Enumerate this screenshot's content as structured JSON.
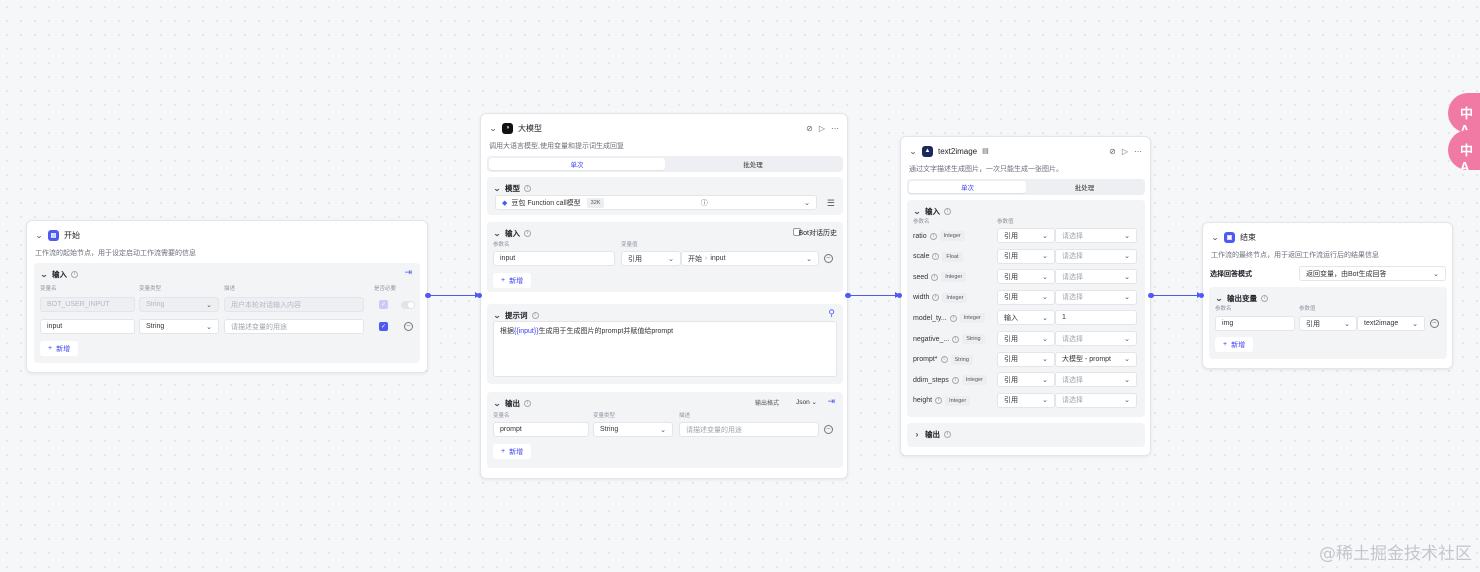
{
  "start": {
    "title": "开始",
    "desc": "工作流的起始节点，用于设定启动工作流需要的信息",
    "input_label": "输入",
    "col_var": "变量名",
    "col_type": "变量类型",
    "col_desc": "描述",
    "col_required": "是否必要",
    "rows": [
      {
        "name": "BOT_USER_INPUT",
        "type": "String",
        "desc": "用户本轮对话输入内容"
      },
      {
        "name": "input",
        "type": "String",
        "desc": "请描述变量的用途"
      }
    ],
    "add_label": "新增"
  },
  "llm": {
    "title": "大模型",
    "desc": "调用大语言模型,使用变量和提示词生成回复",
    "tab_single": "单次",
    "tab_batch": "批处理",
    "model_label": "模型",
    "model_name": "豆包 Function call模型",
    "model_ctx": "32K",
    "input_label": "输入",
    "bot_history": "Bot对话历史",
    "col_param": "参数名",
    "col_value": "变量值",
    "input_row": {
      "name": "input",
      "mode": "引用",
      "src_node": "开始",
      "src_var": "input"
    },
    "add_label": "新增",
    "prompt_label": "提示词",
    "prompt_before": "根据",
    "prompt_var": "{{input}}",
    "prompt_after": "生成用于生成图片的prompt并赋值给prompt",
    "output_label": "输出",
    "output_format_label": "输出格式",
    "output_format": "Json",
    "col_var": "变量名",
    "col_type": "变量类型",
    "col_desc": "描述",
    "output_row": {
      "name": "prompt",
      "type": "String",
      "desc": "请描述变量的用途"
    }
  },
  "t2i": {
    "title": "text2image",
    "desc": "通过文字描述生成图片，一次只能生成一张图片。",
    "tab_single": "单次",
    "tab_batch": "批处理",
    "input_label": "输入",
    "col_param": "参数名",
    "col_value": "参数值",
    "params": [
      {
        "name": "ratio",
        "type": "Integer",
        "mode": "引用",
        "value": "请选择",
        "ph": true
      },
      {
        "name": "scale",
        "type": "Float",
        "mode": "引用",
        "value": "请选择",
        "ph": true
      },
      {
        "name": "seed",
        "type": "Integer",
        "mode": "引用",
        "value": "请选择",
        "ph": true
      },
      {
        "name": "width",
        "type": "Integer",
        "mode": "引用",
        "value": "请选择",
        "ph": true
      },
      {
        "name": "model_ty...",
        "type": "Integer",
        "mode": "输入",
        "value": "1",
        "ph": false
      },
      {
        "name": "negative_...",
        "type": "String",
        "mode": "引用",
        "value": "请选择",
        "ph": true
      },
      {
        "name": "prompt*",
        "type": "String",
        "mode": "引用",
        "value": "大模型 - prompt",
        "ph": false
      },
      {
        "name": "ddim_steps",
        "type": "Integer",
        "mode": "引用",
        "value": "请选择",
        "ph": true
      },
      {
        "name": "height",
        "type": "Integer",
        "mode": "引用",
        "value": "请选择",
        "ph": true
      }
    ],
    "output_label": "输出"
  },
  "end": {
    "title": "结束",
    "desc": "工作流的最终节点，用于返回工作流运行后的结果信息",
    "answer_mode_label": "选择回答模式",
    "answer_mode": "返回变量，由Bot生成回答",
    "output_var_label": "输出变量",
    "col_param": "参数名",
    "col_value": "参数值",
    "row": {
      "name": "img",
      "mode": "引用",
      "value": "text2image"
    },
    "add_label": "新增"
  },
  "floating": {
    "btn_text": "中A"
  },
  "watermark": "@稀土掘金技术社区",
  "colors": {
    "accent": "#4e5bf2",
    "start_icon": "#4e5bf2",
    "end_icon": "#4e5bf2",
    "llm_icon": "#111111",
    "t2i_icon": "#1b2a5c",
    "pink": "#f07aa4"
  }
}
